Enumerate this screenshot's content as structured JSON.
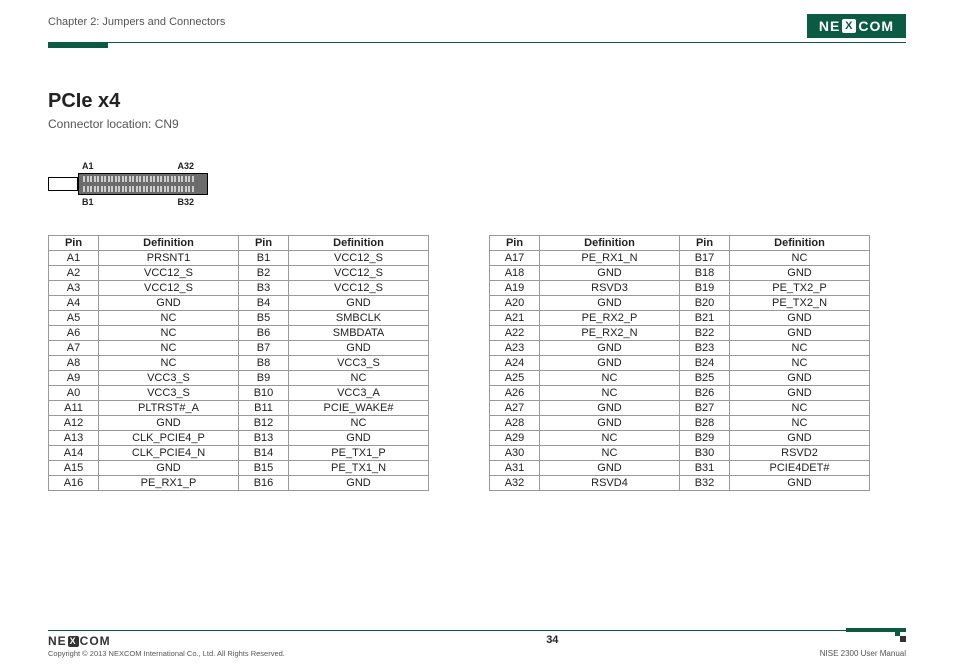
{
  "header": {
    "chapter": "Chapter 2: Jumpers and Connectors",
    "logo_text_left": "NE",
    "logo_text_x": "X",
    "logo_text_right": "COM"
  },
  "main": {
    "title": "PCIe x4",
    "subtitle": "Connector location: CN9",
    "diagram_labels": {
      "tl": "A1",
      "tr": "A32",
      "bl": "B1",
      "br": "B32"
    }
  },
  "tables": {
    "headers": [
      "Pin",
      "Definition",
      "Pin",
      "Definition"
    ],
    "left": [
      [
        "A1",
        "PRSNT1",
        "B1",
        "VCC12_S"
      ],
      [
        "A2",
        "VCC12_S",
        "B2",
        "VCC12_S"
      ],
      [
        "A3",
        "VCC12_S",
        "B3",
        "VCC12_S"
      ],
      [
        "A4",
        "GND",
        "B4",
        "GND"
      ],
      [
        "A5",
        "NC",
        "B5",
        "SMBCLK"
      ],
      [
        "A6",
        "NC",
        "B6",
        "SMBDATA"
      ],
      [
        "A7",
        "NC",
        "B7",
        "GND"
      ],
      [
        "A8",
        "NC",
        "B8",
        "VCC3_S"
      ],
      [
        "A9",
        "VCC3_S",
        "B9",
        "NC"
      ],
      [
        "A0",
        "VCC3_S",
        "B10",
        "VCC3_A"
      ],
      [
        "A11",
        "PLTRST#_A",
        "B11",
        "PCIE_WAKE#"
      ],
      [
        "A12",
        "GND",
        "B12",
        "NC"
      ],
      [
        "A13",
        "CLK_PCIE4_P",
        "B13",
        "GND"
      ],
      [
        "A14",
        "CLK_PCIE4_N",
        "B14",
        "PE_TX1_P"
      ],
      [
        "A15",
        "GND",
        "B15",
        "PE_TX1_N"
      ],
      [
        "A16",
        "PE_RX1_P",
        "B16",
        "GND"
      ]
    ],
    "right": [
      [
        "A17",
        "PE_RX1_N",
        "B17",
        "NC"
      ],
      [
        "A18",
        "GND",
        "B18",
        "GND"
      ],
      [
        "A19",
        "RSVD3",
        "B19",
        "PE_TX2_P"
      ],
      [
        "A20",
        "GND",
        "B20",
        "PE_TX2_N"
      ],
      [
        "A21",
        "PE_RX2_P",
        "B21",
        "GND"
      ],
      [
        "A22",
        "PE_RX2_N",
        "B22",
        "GND"
      ],
      [
        "A23",
        "GND",
        "B23",
        "NC"
      ],
      [
        "A24",
        "GND",
        "B24",
        "NC"
      ],
      [
        "A25",
        "NC",
        "B25",
        "GND"
      ],
      [
        "A26",
        "NC",
        "B26",
        "GND"
      ],
      [
        "A27",
        "GND",
        "B27",
        "NC"
      ],
      [
        "A28",
        "GND",
        "B28",
        "NC"
      ],
      [
        "A29",
        "NC",
        "B29",
        "GND"
      ],
      [
        "A30",
        "NC",
        "B30",
        "RSVD2"
      ],
      [
        "A31",
        "GND",
        "B31",
        "PCIE4DET#"
      ],
      [
        "A32",
        "RSVD4",
        "B32",
        "GND"
      ]
    ]
  },
  "footer": {
    "logo_left": "NE",
    "logo_x": "X",
    "logo_right": "COM",
    "copyright": "Copyright © 2013 NEXCOM International Co., Ltd. All Rights Reserved.",
    "page": "34",
    "manual": "NISE 2300 User Manual"
  }
}
